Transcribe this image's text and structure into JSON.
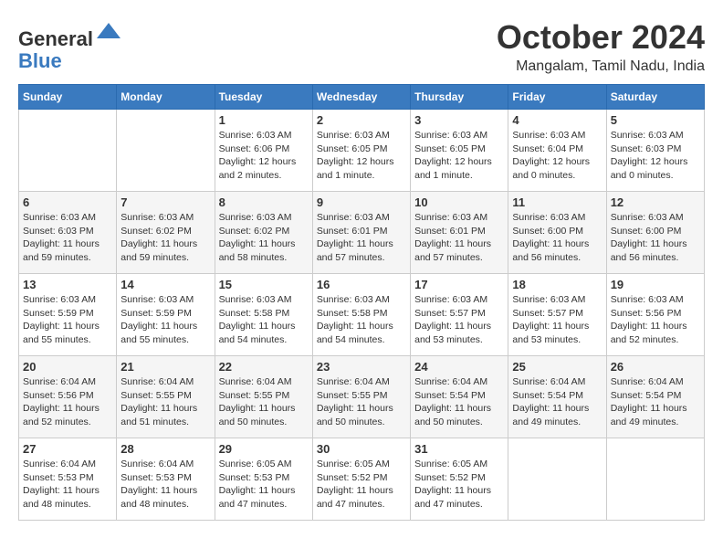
{
  "logo": {
    "general": "General",
    "blue": "Blue"
  },
  "title": "October 2024",
  "location": "Mangalam, Tamil Nadu, India",
  "days_header": [
    "Sunday",
    "Monday",
    "Tuesday",
    "Wednesday",
    "Thursday",
    "Friday",
    "Saturday"
  ],
  "weeks": [
    [
      {
        "day": "",
        "info": ""
      },
      {
        "day": "",
        "info": ""
      },
      {
        "day": "1",
        "info": "Sunrise: 6:03 AM\nSunset: 6:06 PM\nDaylight: 12 hours\nand 2 minutes."
      },
      {
        "day": "2",
        "info": "Sunrise: 6:03 AM\nSunset: 6:05 PM\nDaylight: 12 hours\nand 1 minute."
      },
      {
        "day": "3",
        "info": "Sunrise: 6:03 AM\nSunset: 6:05 PM\nDaylight: 12 hours\nand 1 minute."
      },
      {
        "day": "4",
        "info": "Sunrise: 6:03 AM\nSunset: 6:04 PM\nDaylight: 12 hours\nand 0 minutes."
      },
      {
        "day": "5",
        "info": "Sunrise: 6:03 AM\nSunset: 6:03 PM\nDaylight: 12 hours\nand 0 minutes."
      }
    ],
    [
      {
        "day": "6",
        "info": "Sunrise: 6:03 AM\nSunset: 6:03 PM\nDaylight: 11 hours\nand 59 minutes."
      },
      {
        "day": "7",
        "info": "Sunrise: 6:03 AM\nSunset: 6:02 PM\nDaylight: 11 hours\nand 59 minutes."
      },
      {
        "day": "8",
        "info": "Sunrise: 6:03 AM\nSunset: 6:02 PM\nDaylight: 11 hours\nand 58 minutes."
      },
      {
        "day": "9",
        "info": "Sunrise: 6:03 AM\nSunset: 6:01 PM\nDaylight: 11 hours\nand 57 minutes."
      },
      {
        "day": "10",
        "info": "Sunrise: 6:03 AM\nSunset: 6:01 PM\nDaylight: 11 hours\nand 57 minutes."
      },
      {
        "day": "11",
        "info": "Sunrise: 6:03 AM\nSunset: 6:00 PM\nDaylight: 11 hours\nand 56 minutes."
      },
      {
        "day": "12",
        "info": "Sunrise: 6:03 AM\nSunset: 6:00 PM\nDaylight: 11 hours\nand 56 minutes."
      }
    ],
    [
      {
        "day": "13",
        "info": "Sunrise: 6:03 AM\nSunset: 5:59 PM\nDaylight: 11 hours\nand 55 minutes."
      },
      {
        "day": "14",
        "info": "Sunrise: 6:03 AM\nSunset: 5:59 PM\nDaylight: 11 hours\nand 55 minutes."
      },
      {
        "day": "15",
        "info": "Sunrise: 6:03 AM\nSunset: 5:58 PM\nDaylight: 11 hours\nand 54 minutes."
      },
      {
        "day": "16",
        "info": "Sunrise: 6:03 AM\nSunset: 5:58 PM\nDaylight: 11 hours\nand 54 minutes."
      },
      {
        "day": "17",
        "info": "Sunrise: 6:03 AM\nSunset: 5:57 PM\nDaylight: 11 hours\nand 53 minutes."
      },
      {
        "day": "18",
        "info": "Sunrise: 6:03 AM\nSunset: 5:57 PM\nDaylight: 11 hours\nand 53 minutes."
      },
      {
        "day": "19",
        "info": "Sunrise: 6:03 AM\nSunset: 5:56 PM\nDaylight: 11 hours\nand 52 minutes."
      }
    ],
    [
      {
        "day": "20",
        "info": "Sunrise: 6:04 AM\nSunset: 5:56 PM\nDaylight: 11 hours\nand 52 minutes."
      },
      {
        "day": "21",
        "info": "Sunrise: 6:04 AM\nSunset: 5:55 PM\nDaylight: 11 hours\nand 51 minutes."
      },
      {
        "day": "22",
        "info": "Sunrise: 6:04 AM\nSunset: 5:55 PM\nDaylight: 11 hours\nand 50 minutes."
      },
      {
        "day": "23",
        "info": "Sunrise: 6:04 AM\nSunset: 5:55 PM\nDaylight: 11 hours\nand 50 minutes."
      },
      {
        "day": "24",
        "info": "Sunrise: 6:04 AM\nSunset: 5:54 PM\nDaylight: 11 hours\nand 50 minutes."
      },
      {
        "day": "25",
        "info": "Sunrise: 6:04 AM\nSunset: 5:54 PM\nDaylight: 11 hours\nand 49 minutes."
      },
      {
        "day": "26",
        "info": "Sunrise: 6:04 AM\nSunset: 5:54 PM\nDaylight: 11 hours\nand 49 minutes."
      }
    ],
    [
      {
        "day": "27",
        "info": "Sunrise: 6:04 AM\nSunset: 5:53 PM\nDaylight: 11 hours\nand 48 minutes."
      },
      {
        "day": "28",
        "info": "Sunrise: 6:04 AM\nSunset: 5:53 PM\nDaylight: 11 hours\nand 48 minutes."
      },
      {
        "day": "29",
        "info": "Sunrise: 6:05 AM\nSunset: 5:53 PM\nDaylight: 11 hours\nand 47 minutes."
      },
      {
        "day": "30",
        "info": "Sunrise: 6:05 AM\nSunset: 5:52 PM\nDaylight: 11 hours\nand 47 minutes."
      },
      {
        "day": "31",
        "info": "Sunrise: 6:05 AM\nSunset: 5:52 PM\nDaylight: 11 hours\nand 47 minutes."
      },
      {
        "day": "",
        "info": ""
      },
      {
        "day": "",
        "info": ""
      }
    ]
  ]
}
